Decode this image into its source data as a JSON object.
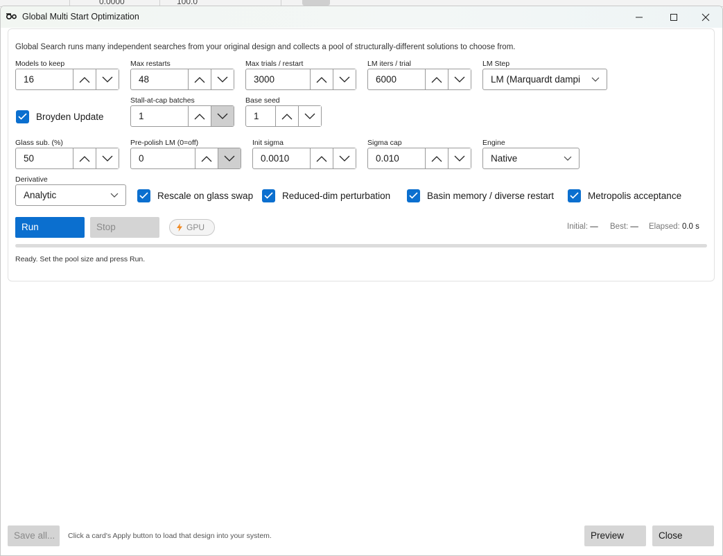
{
  "background_app": {
    "visible_text": [
      "0.0000",
      "100.0"
    ]
  },
  "window": {
    "title": "Global Multi Start Optimization"
  },
  "description": "Global Search runs many independent searches from your original design and collects a pool of structurally-different solutions to choose from.",
  "fields": {
    "models_to_keep": {
      "label": "Models to keep",
      "value": "16"
    },
    "max_restarts": {
      "label": "Max restarts",
      "value": "48"
    },
    "max_trials": {
      "label": "Max trials / restart",
      "value": "3000"
    },
    "lm_iters": {
      "label": "LM iters / trial",
      "value": "6000"
    },
    "lm_step": {
      "label": "LM Step",
      "value": "LM (Marquardt dampi"
    },
    "stall_at_cap": {
      "label": "Stall-at-cap batches",
      "value": "1"
    },
    "base_seed": {
      "label": "Base seed",
      "value": "1"
    },
    "glass_sub": {
      "label": "Glass sub. (%)",
      "value": "50"
    },
    "pre_polish_lm": {
      "label": "Pre-polish LM (0=off)",
      "value": "0"
    },
    "init_sigma": {
      "label": "Init sigma",
      "value": "0.0010"
    },
    "sigma_cap": {
      "label": "Sigma cap",
      "value": "0.010"
    },
    "engine": {
      "label": "Engine",
      "value": "Native"
    },
    "derivative": {
      "label": "Derivative",
      "value": "Analytic"
    }
  },
  "checkboxes": {
    "broyden": {
      "label": "Broyden Update",
      "checked": true
    },
    "rescale": {
      "label": "Rescale on glass swap",
      "checked": true
    },
    "reduced_dim": {
      "label": "Reduced-dim perturbation",
      "checked": true
    },
    "basin": {
      "label": "Basin memory / diverse restart",
      "checked": true
    },
    "metropolis": {
      "label": "Metropolis acceptance",
      "checked": true
    }
  },
  "actions": {
    "run": "Run",
    "stop": "Stop",
    "gpu": "GPU"
  },
  "stats": {
    "initial_label": "Initial:",
    "initial_value": "—",
    "best_label": "Best:",
    "best_value": "—",
    "elapsed_label": "Elapsed:",
    "elapsed_value": "0.0 s"
  },
  "progress": {
    "fraction": 0
  },
  "status": "Ready. Set the pool size and press Run.",
  "footer": {
    "save_all": "Save all...",
    "hint": "Click a card's Apply button to load that design into your system.",
    "preview": "Preview",
    "close": "Close"
  },
  "colors": {
    "accent": "#0b6fcf",
    "disabled_bg": "#d4d4d4",
    "gpu_bolt": "#f08a24"
  },
  "icons": [
    "app-icon",
    "minimize-icon",
    "maximize-icon",
    "close-icon",
    "chevron-up-icon",
    "chevron-down-icon",
    "checkmark-icon",
    "lightning-icon"
  ]
}
